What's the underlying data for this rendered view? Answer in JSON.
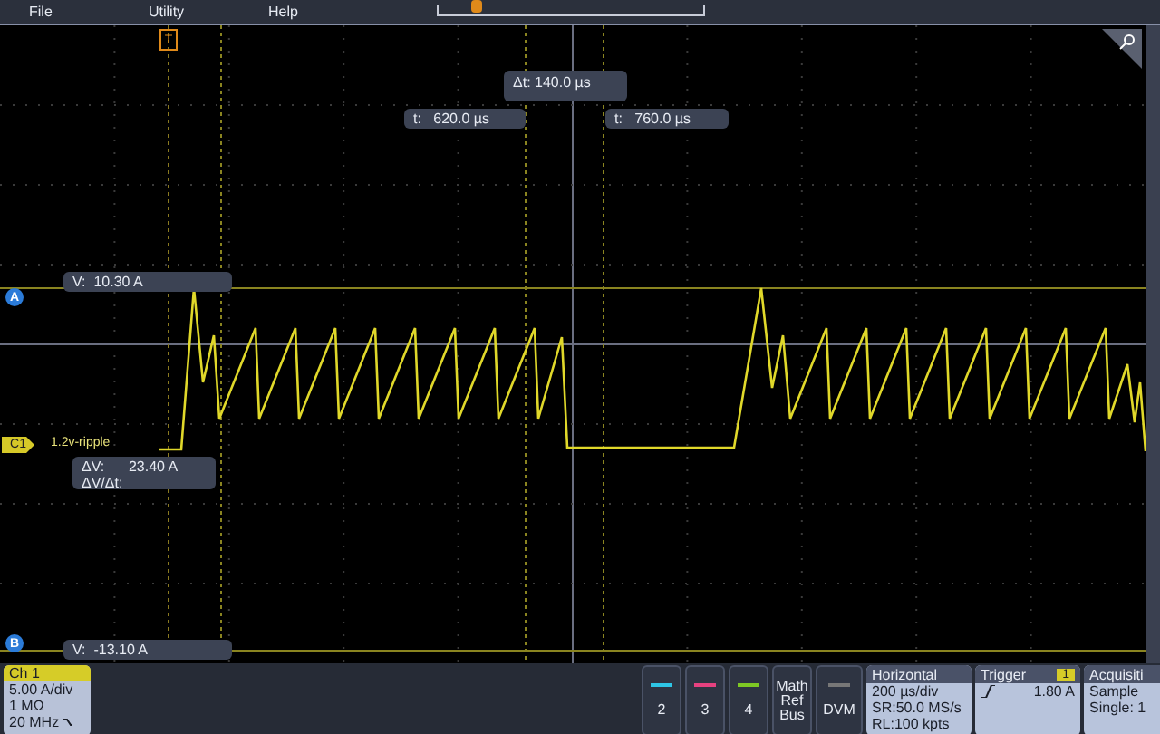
{
  "menu": [
    {
      "label": "File"
    },
    {
      "label": "Utility"
    },
    {
      "label": "Help"
    }
  ],
  "trigger_marker": "T",
  "time_cursors": {
    "delta": {
      "label": "Δt:",
      "value": "140.0 µs"
    },
    "t1": {
      "label": "t:",
      "value": "620.0 µs"
    },
    "t2": {
      "label": "t:",
      "value": "760.0 µs"
    }
  },
  "voltage_cursors": [
    {
      "marker": "A",
      "label": "V:",
      "value": "10.30 A"
    },
    {
      "marker": "B",
      "label": "V:",
      "value": "-13.10 A"
    }
  ],
  "channel_label": {
    "badge": "C1",
    "name": "1.2v-ripple"
  },
  "delta_readout": [
    {
      "label": "ΔV:",
      "value": "23.40 A"
    },
    {
      "label": "ΔV/Δt:"
    }
  ],
  "channel_1": {
    "title": "Ch 1",
    "lines": [
      "5.00 A/div",
      "1 MΩ",
      "20 MHz"
    ]
  },
  "channel_buttons": [
    {
      "label": "2",
      "color": "#2ec6e6"
    },
    {
      "label": "3",
      "color": "#e6417f"
    },
    {
      "label": "4",
      "color": "#7ec824"
    }
  ],
  "math_button": {
    "lines": [
      "Math",
      "Ref",
      "Bus"
    ]
  },
  "dvm_button": {
    "label": "DVM"
  },
  "horizontal": {
    "title": "Horizontal",
    "lines": [
      "200 µs/div",
      "SR:50.0 MS/s",
      "RL:100 kpts"
    ]
  },
  "trigger": {
    "title": "Trigger",
    "source": "1",
    "level": "1.80 A"
  },
  "acquisition": {
    "title": "Acquisiti",
    "lines": [
      "Sample",
      "Single: 1"
    ]
  }
}
